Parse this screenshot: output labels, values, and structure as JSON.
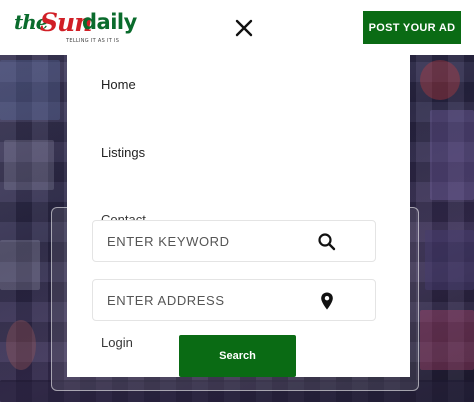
{
  "logo": {
    "part1": "the",
    "part2": "Sun",
    "part3": "daily",
    "tagline": "TELLING IT AS IT IS"
  },
  "header": {
    "post_ad_label": "POST YOUR AD"
  },
  "menu": {
    "items": [
      "Home",
      "Listings",
      "Contact",
      "Login"
    ]
  },
  "search": {
    "keyword_placeholder": "ENTER KEYWORD",
    "address_placeholder": "ENTER ADDRESS",
    "button_label": "Search"
  },
  "icons": {
    "close": "close-icon",
    "search": "search-icon",
    "location": "map-pin-icon"
  },
  "colors": {
    "brand_green": "#0a6b14",
    "logo_red": "#d11f26"
  }
}
